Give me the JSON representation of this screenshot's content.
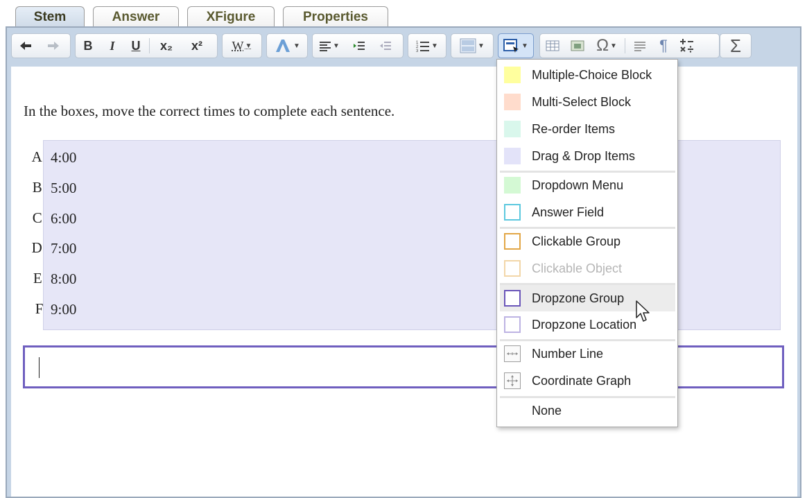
{
  "tabs": [
    {
      "label": "Stem",
      "active": true
    },
    {
      "label": "Answer",
      "active": false
    },
    {
      "label": "XFigure",
      "active": false
    },
    {
      "label": "Properties",
      "active": false
    }
  ],
  "toolbar": {
    "bold": "B",
    "italic": "I",
    "underline": "U",
    "subscript": "x₂",
    "superscript": "x²",
    "word": "W",
    "omega": "Ω",
    "pilcrow": "¶",
    "sigma": "Σ"
  },
  "question": {
    "stem": "In the boxes, move the correct times to complete each sentence.",
    "choices": [
      {
        "letter": "A.",
        "text": "4:00"
      },
      {
        "letter": "B.",
        "text": "5:00"
      },
      {
        "letter": "C.",
        "text": "6:00"
      },
      {
        "letter": "D.",
        "text": "7:00"
      },
      {
        "letter": "E.",
        "text": "8:00"
      },
      {
        "letter": "F.",
        "text": "9:00"
      }
    ]
  },
  "menu": {
    "items": [
      {
        "label": "Multiple-Choice Block",
        "swatch": "#ffff9e",
        "style": "fill"
      },
      {
        "label": "Multi-Select Block",
        "swatch": "#ffdccc",
        "style": "fill"
      },
      {
        "label": "Re-order Items",
        "swatch": "#d9f7ec",
        "style": "fill"
      },
      {
        "label": "Drag & Drop Items",
        "swatch": "#e3e3f9",
        "style": "fill"
      },
      {
        "label": "Dropdown Menu",
        "swatch": "#d4f9d4",
        "style": "fill"
      },
      {
        "label": "Answer Field",
        "swatch": "#5cc8de",
        "style": "outline"
      },
      {
        "label": "Clickable Group",
        "swatch": "#e2a645",
        "style": "outline"
      },
      {
        "label": "Clickable Object",
        "swatch": "#f2d6a8",
        "style": "outline",
        "disabled": true
      },
      {
        "label": "Dropzone Group",
        "swatch": "#6a55b9",
        "style": "outline"
      },
      {
        "label": "Dropzone Location",
        "swatch": "#bdb3e3",
        "style": "outline"
      },
      {
        "label": "Number Line",
        "icon": "number-line-icon",
        "style": "icon"
      },
      {
        "label": "Coordinate Graph",
        "icon": "coordinate-graph-icon",
        "style": "icon"
      },
      {
        "label": "None",
        "style": "none"
      }
    ]
  },
  "colors": {
    "dropzone_border": "#6f5fbf",
    "choices_bg": "#e6e6f7",
    "frame_bg": "#c6d5e6"
  }
}
